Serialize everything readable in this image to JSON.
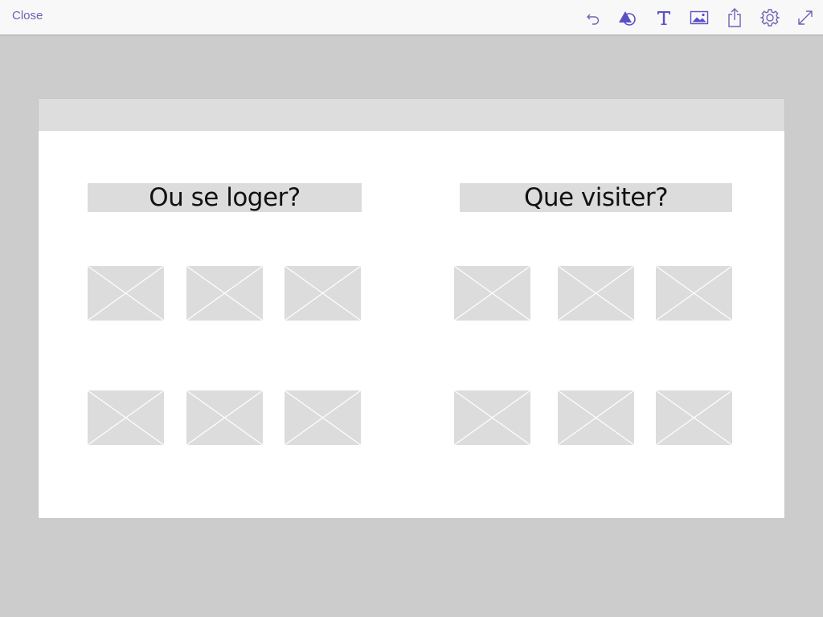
{
  "toolbar": {
    "close_label": "Close",
    "tools": [
      "undo-icon",
      "shapes-icon",
      "text-icon",
      "image-icon",
      "share-icon",
      "settings-icon",
      "expand-icon"
    ],
    "accent_color": "#5b4fc4"
  },
  "canvas": {
    "left_section": {
      "heading": "Ou se loger?",
      "image_placeholders": 6
    },
    "right_section": {
      "heading": "Que visiter?",
      "image_placeholders": 6
    }
  }
}
